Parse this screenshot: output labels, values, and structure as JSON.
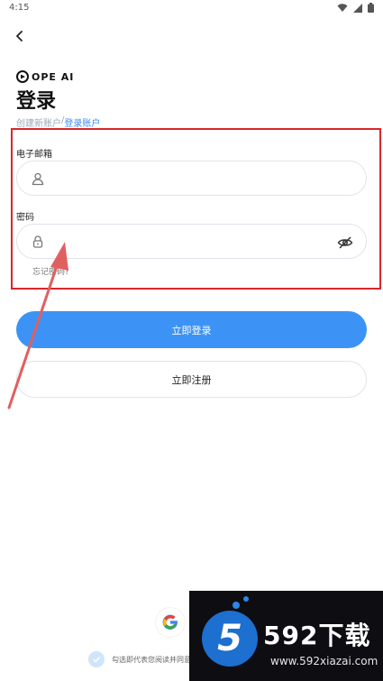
{
  "status_bar": {
    "time": "4:15"
  },
  "brand": {
    "logo_text": "OPE AI"
  },
  "page": {
    "title": "登录",
    "breadcrumb": {
      "first": "创建新账户",
      "separator": "/",
      "second": "登录账户"
    }
  },
  "form": {
    "email_label": "电子邮箱",
    "email_value": "",
    "email_placeholder": "",
    "password_label": "密码",
    "password_value": "",
    "password_placeholder": "",
    "forgot_password": "忘记密码?"
  },
  "actions": {
    "login_label": "立即登录",
    "register_label": "立即注册"
  },
  "footer": {
    "agree_text": "勾选即代表您阅读并同意"
  },
  "watermark": {
    "brand": "592下载",
    "url": "www.592xiazai.com"
  },
  "colors": {
    "primary": "#3d93f5",
    "link": "#3d8bf2",
    "highlight_box": "#d8262b",
    "annotation_arrow": "#e06060"
  }
}
